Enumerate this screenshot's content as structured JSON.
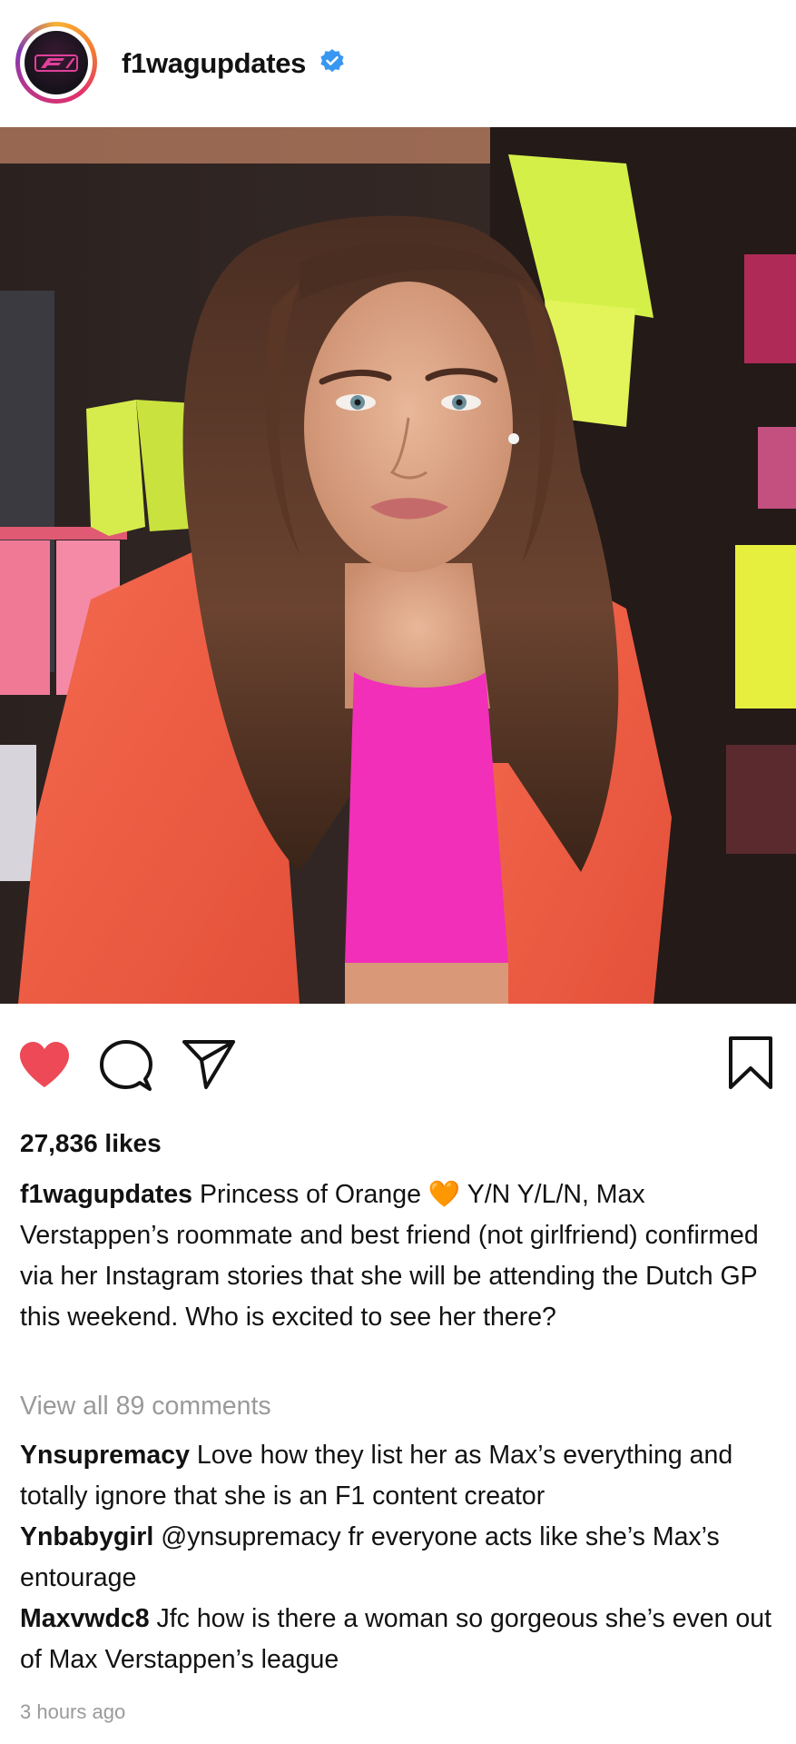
{
  "post": {
    "username": "f1wagupdates",
    "verified_icon": "verified-badge-icon",
    "avatar_icon": "f1-logo-icon",
    "likes": "27,836 likes",
    "caption": {
      "author": "f1wagupdates",
      "text_before_emoji": "Princess of Orange",
      "emoji": "🧡",
      "text_after_emoji": "Y/N Y/L/N, Max Verstappen’s roommate and best friend (not girlfriend) confirmed via her Instagram stories that she will be attending the Dutch GP this weekend. Who is excited to see her there?"
    },
    "view_all_comments": "View all 89 comments",
    "comments": [
      {
        "author": "Ynsupremacy",
        "text": "Love how they list her as Max’s everything and totally ignore that she is an F1 content creator"
      },
      {
        "author": "Ynbabygirl",
        "text": "@ynsupremacy fr everyone acts like she’s Max’s entourage"
      },
      {
        "author": "Maxvwdc8",
        "text": "Jfc how is there a woman so gorgeous she’s even out of Max Verstappen’s league"
      }
    ],
    "timestamp": "3 hours ago"
  },
  "actions": {
    "like_icon": "heart-filled-icon",
    "comment_icon": "comment-bubble-icon",
    "share_icon": "paper-plane-icon",
    "save_icon": "bookmark-icon"
  },
  "colors": {
    "heart": "#ed4956",
    "verified": "#3897f0",
    "muted_text": "#9a9a9a"
  }
}
